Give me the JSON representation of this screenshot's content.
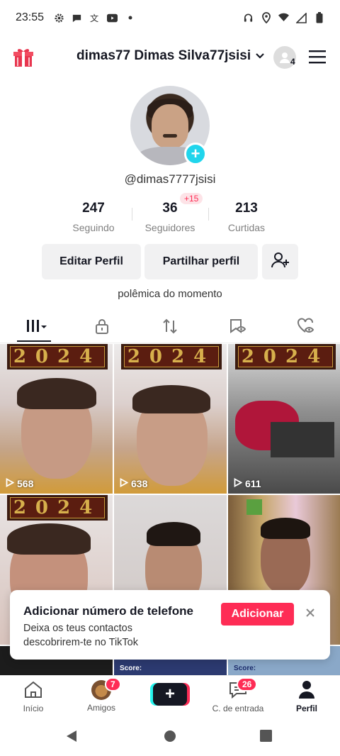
{
  "status": {
    "time": "23:55"
  },
  "header": {
    "account_name": "dimas77 Dimas Silva77jsisi",
    "friends_count": "4"
  },
  "profile": {
    "handle": "@dimas7777jsisi",
    "stats": [
      {
        "value": "247",
        "label": "Seguindo"
      },
      {
        "value": "36",
        "label": "Seguidores",
        "delta": "+15"
      },
      {
        "value": "213",
        "label": "Curtidas"
      }
    ],
    "edit_label": "Editar Perfil",
    "share_label": "Partilhar perfil",
    "bio": "polêmica do momento"
  },
  "grid": {
    "videos": [
      {
        "views": "568",
        "banner": "2024"
      },
      {
        "views": "638",
        "banner": "2024"
      },
      {
        "views": "611",
        "banner": "2024"
      },
      {
        "banner": "2024"
      },
      {},
      {}
    ],
    "score_label": "Score:"
  },
  "toast": {
    "title": "Adicionar número de telefone",
    "body": "Deixa os teus contactos descobrirem-te no TikTok",
    "action": "Adicionar"
  },
  "nav": {
    "home": "Início",
    "friends": "Amigos",
    "friends_badge": "7",
    "inbox": "C. de entrada",
    "inbox_badge": "26",
    "profile": "Perfil"
  },
  "colors": {
    "accent": "#fe2c55",
    "cyan": "#20d5ec"
  }
}
